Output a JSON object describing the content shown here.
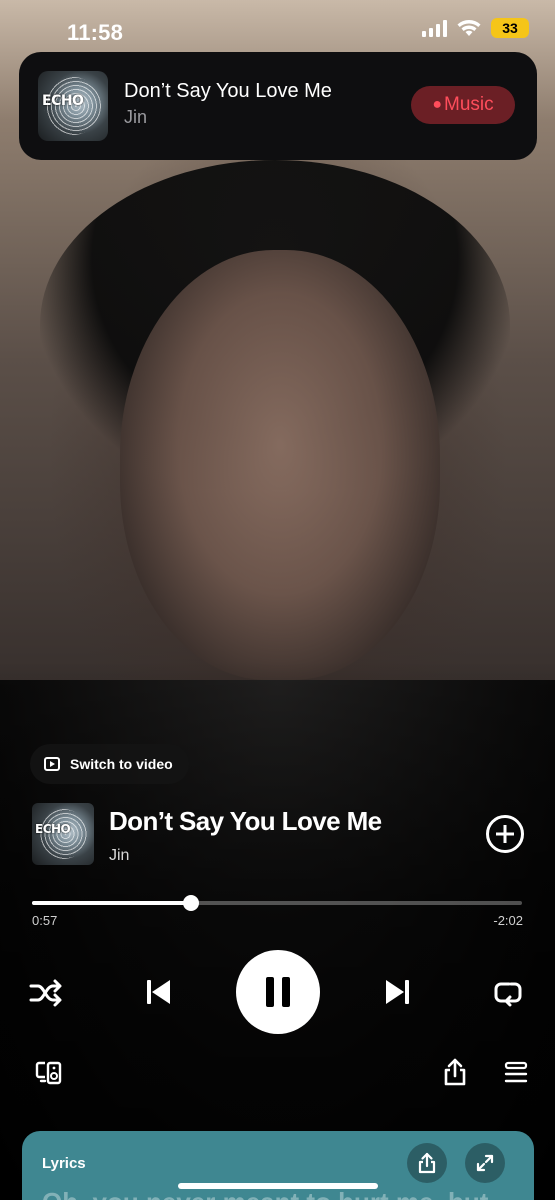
{
  "status_bar": {
    "time": "11:58",
    "battery": "33"
  },
  "banner": {
    "title": "Don’t Say You Love Me",
    "artist": "Jin",
    "service_label": "Music",
    "art_text": "ECHO"
  },
  "player": {
    "switch_video_label": "Switch to video",
    "title": "Don’t Say You Love Me",
    "artist": "Jin",
    "art_text": "ECHO",
    "elapsed": "0:57",
    "remaining": "-2:02",
    "progress": 0.325
  },
  "lyrics": {
    "label": "Lyrics",
    "line": "Oh, you never meant to hurt me, but"
  },
  "colors": {
    "accent": "#ff4d5b",
    "lyrics_card": "#3f8791",
    "battery": "#f5c518"
  }
}
